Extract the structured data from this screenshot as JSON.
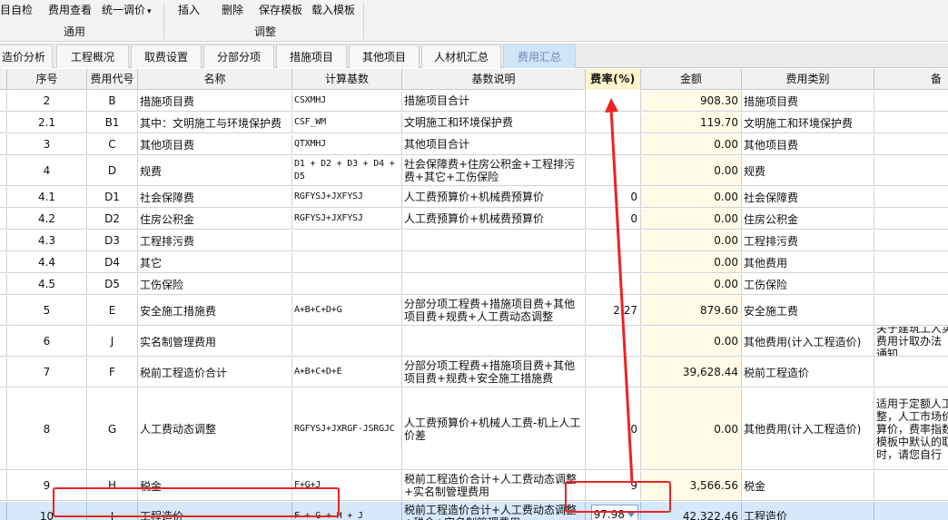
{
  "ribbon": {
    "buttons": [
      "项目自检",
      "费用查看",
      "统一调价",
      "插入",
      "删除",
      "保存模板",
      "载入模板"
    ],
    "groups": [
      "通用",
      "调整"
    ],
    "dropdown_glyph": "▾"
  },
  "tabs": [
    {
      "label": "造价分析",
      "active": false
    },
    {
      "label": "工程概况",
      "active": false
    },
    {
      "label": "取费设置",
      "active": false
    },
    {
      "label": "分部分项",
      "active": false
    },
    {
      "label": "措施项目",
      "active": false
    },
    {
      "label": "其他项目",
      "active": false
    },
    {
      "label": "人材机汇总",
      "active": false
    },
    {
      "label": "费用汇总",
      "active": true
    }
  ],
  "table": {
    "columns": [
      "序号",
      "费用代号",
      "名称",
      "计算基数",
      "基数说明",
      "费率(%)",
      "金额",
      "费用类别",
      "备"
    ],
    "rows": [
      {
        "seq": "2",
        "code": "B",
        "name": "措施项目费",
        "base": "CSXMHJ",
        "desc": "措施项目合计",
        "rate": "",
        "amount": "908.30",
        "category": "措施项目费",
        "note": ""
      },
      {
        "seq": "2.1",
        "code": "B1",
        "name": "其中：文明施工与环境保护费",
        "base": "CSF_WM",
        "desc": "文明施工和环境保护费",
        "rate": "",
        "amount": "119.70",
        "category": "文明施工和环境保护费",
        "note": ""
      },
      {
        "seq": "3",
        "code": "C",
        "name": "其他项目费",
        "base": "QTXMHJ",
        "desc": "其他项目合计",
        "rate": "",
        "amount": "0.00",
        "category": "其他项目费",
        "note": ""
      },
      {
        "seq": "4",
        "code": "D",
        "name": "规费",
        "base": "D1 + D2 + D3 + D4 + D5",
        "desc": "社会保障费+住房公积金+工程排污费+其它+工伤保险",
        "rate": "",
        "amount": "0.00",
        "category": "规费",
        "note": ""
      },
      {
        "seq": "4.1",
        "code": "D1",
        "name": "社会保障费",
        "base": "RGFYSJ+JXFYSJ",
        "desc": "人工费预算价+机械费预算价",
        "rate": "0",
        "amount": "0.00",
        "category": "社会保障费",
        "note": ""
      },
      {
        "seq": "4.2",
        "code": "D2",
        "name": "住房公积金",
        "base": "RGFYSJ+JXFYSJ",
        "desc": "人工费预算价+机械费预算价",
        "rate": "0",
        "amount": "0.00",
        "category": "住房公积金",
        "note": ""
      },
      {
        "seq": "4.3",
        "code": "D3",
        "name": "工程排污费",
        "base": "",
        "desc": "",
        "rate": "",
        "amount": "0.00",
        "category": "工程排污费",
        "note": ""
      },
      {
        "seq": "4.4",
        "code": "D4",
        "name": "其它",
        "base": "",
        "desc": "",
        "rate": "",
        "amount": "0.00",
        "category": "其他费用",
        "note": ""
      },
      {
        "seq": "4.5",
        "code": "D5",
        "name": "工伤保险",
        "base": "",
        "desc": "",
        "rate": "",
        "amount": "0.00",
        "category": "工伤保险",
        "note": ""
      },
      {
        "seq": "5",
        "code": "E",
        "name": "安全施工措施费",
        "base": "A+B+C+D+G",
        "desc": "分部分项工程费+措施项目费+其他项目费+规费+人工费动态调整",
        "rate": "2.27",
        "amount": "879.60",
        "category": "安全施工费",
        "note": ""
      },
      {
        "seq": "6",
        "code": "J",
        "name": "实名制管理费用",
        "base": "",
        "desc": "",
        "rate": "",
        "amount": "0.00",
        "category": "其他费用(计入工程造价)",
        "note": "关于建筑工人实名制管理费用计取办法（暂行）的通知"
      },
      {
        "seq": "7",
        "code": "F",
        "name": "税前工程造价合计",
        "base": "A+B+C+D+E",
        "desc": "分部分项工程费+措施项目费+其他项目费+规费+安全施工措施费",
        "rate": "",
        "amount": "39,628.44",
        "category": "税前工程造价",
        "note": ""
      },
      {
        "seq": "8",
        "code": "G",
        "name": "人工费动态调整",
        "base": "RGFYSJ+JXRGF-JSRGJC",
        "desc": "人工费预算价+机械人工费-机上人工价差",
        "rate": "0",
        "amount": "0.00",
        "category": "其他费用(计入工程造价)",
        "note": "适用于定额人工价格不调整，人工市场价格等于预算价，费率指数根据实际模板中默认的取费要求时，请您自行"
      },
      {
        "seq": "9",
        "code": "H",
        "name": "税金",
        "base": "F+G+J",
        "desc": "税前工程造价合计+人工费动态调整+实名制管理费用",
        "rate": "9",
        "amount": "3,566.56",
        "category": "税金",
        "note": ""
      },
      {
        "seq": "10",
        "code": "I",
        "name": "工程造价",
        "base": "F + G + H + J",
        "desc": "税前工程造价合计+人工费动态调整+税金+实名制管理费用",
        "rate": "97.98",
        "amount": "42,322.46",
        "category": "工程造价",
        "note": ""
      }
    ]
  },
  "colors": {
    "annotation_red": "#e22222",
    "selected_row": "#d6e8fb",
    "active_tab": "#cfe6f9",
    "rate_header": "#fff4cc"
  }
}
